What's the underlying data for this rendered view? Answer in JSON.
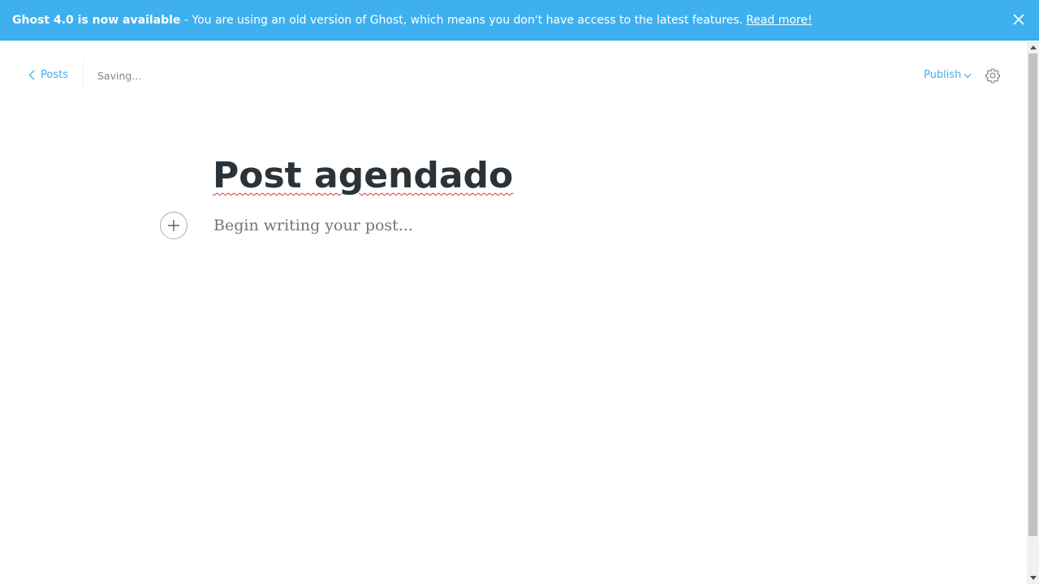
{
  "banner": {
    "bold_text": "Ghost 4.0 is now available",
    "message": " - You are using an old version of Ghost, which means you don't have access to the latest features.",
    "link_text": "Read more!",
    "close_icon": "close-icon",
    "background_color": "#3eb0ef"
  },
  "topbar": {
    "back_label": "Posts",
    "back_icon": "chevron-left-icon",
    "status": "Saving...",
    "publish_label": "Publish",
    "publish_icon": "chevron-down-icon",
    "settings_icon": "gear-icon",
    "accent_color": "#3eb0ef"
  },
  "post": {
    "title": "Post agendado",
    "body_placeholder": "Begin writing your post...",
    "add_card_icon": "plus-icon"
  }
}
